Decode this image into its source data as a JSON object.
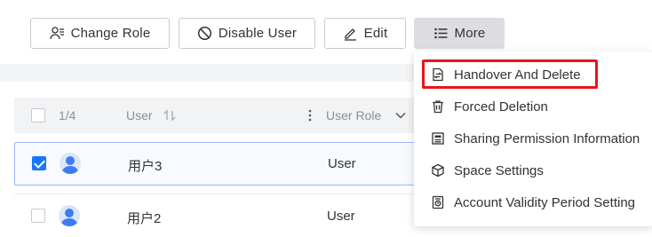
{
  "toolbar": {
    "change_role": "Change Role",
    "disable_user": "Disable User",
    "edit": "Edit",
    "more": "More"
  },
  "table": {
    "selection_count": "1/4",
    "columns": {
      "user": "User",
      "user_role": "User Role"
    },
    "rows": [
      {
        "name": "用户3",
        "role": "User",
        "checked": true
      },
      {
        "name": "用户2",
        "role": "User",
        "checked": false
      }
    ]
  },
  "more_menu": {
    "items": [
      {
        "label": "Handover And Delete",
        "icon": "transfer-file-icon",
        "highlighted": true
      },
      {
        "label": "Forced Deletion",
        "icon": "trash-icon"
      },
      {
        "label": "Sharing Permission Information",
        "icon": "document-list-icon"
      },
      {
        "label": "Space Settings",
        "icon": "cube-icon"
      },
      {
        "label": "Account Validity Period Setting",
        "icon": "clock-card-icon"
      }
    ]
  },
  "colors": {
    "accent": "#1677ff",
    "highlight_border": "#e8151c",
    "header_bg": "#f2f3f5"
  }
}
